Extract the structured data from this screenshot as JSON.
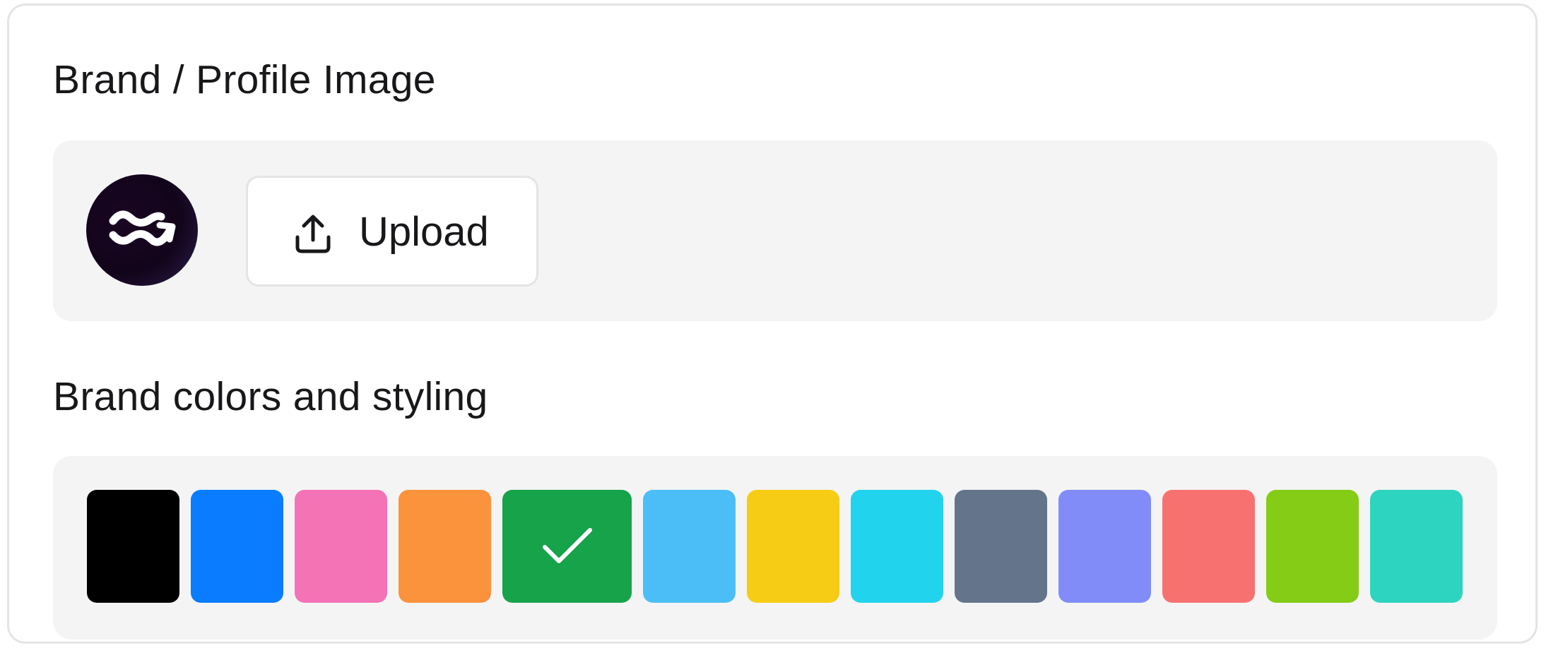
{
  "profile_section": {
    "title": "Brand / Profile Image",
    "upload_label": "Upload",
    "upload_icon": "upload-icon",
    "avatar_icon": "wave-arrow-logo"
  },
  "colors_section": {
    "title": "Brand colors and styling",
    "selected_index": 4,
    "swatches": [
      {
        "color": "#000000",
        "selected": false
      },
      {
        "color": "#0a7cff",
        "selected": false
      },
      {
        "color": "#f472b6",
        "selected": false
      },
      {
        "color": "#fb923c",
        "selected": false
      },
      {
        "color": "#16a34a",
        "selected": true
      },
      {
        "color": "#4bbef8",
        "selected": false
      },
      {
        "color": "#f7cc15",
        "selected": false
      },
      {
        "color": "#22d3ee",
        "selected": false
      },
      {
        "color": "#64748b",
        "selected": false
      },
      {
        "color": "#818cf8",
        "selected": false
      },
      {
        "color": "#f87171",
        "selected": false
      },
      {
        "color": "#84cc16",
        "selected": false
      },
      {
        "color": "#2dd4bf",
        "selected": false
      }
    ]
  }
}
